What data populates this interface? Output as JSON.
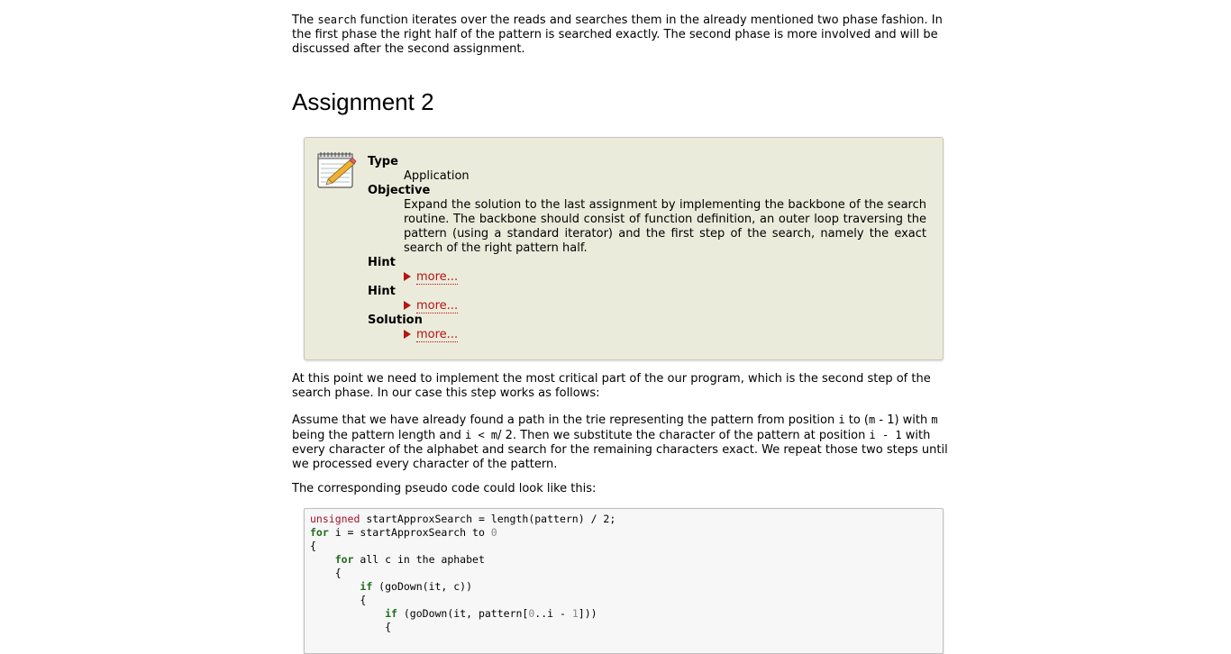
{
  "intro": {
    "before": "The ",
    "code": "search",
    "after": " function iterates over the reads and searches them in the already mentioned two phase fashion. In the first phase the right half of the pattern is searched exactly. The second phase is more involved and will be discussed after the second assignment."
  },
  "heading": "Assignment 2",
  "assignment": {
    "icon": "notepad-pencil-icon",
    "type_label": "Type",
    "type_value": "Application",
    "objective_label": "Objective",
    "objective_value": "Expand the solution to the last assignment by implementing the backbone of the search routine. The backbone should consist of function definition, an outer loop traversing the pattern (using a standard iterator) and the first step of the search, namely the exact search of the right pattern half.",
    "hint1_label": "Hint",
    "hint2_label": "Hint",
    "solution_label": "Solution",
    "more_label": "more..."
  },
  "para_critical": "At this point we need to implement the most critical part of the our program, which is the second step of the search phase. In our case this step works as follows:",
  "para_assume": {
    "t1": "Assume that we have already found a path in the trie representing the pattern from position ",
    "c1": "i",
    "t2": " to (",
    "c2": "m",
    "t3": " - 1) with ",
    "c3": "m",
    "t4": " being the pattern length and ",
    "c4": "i < m",
    "t5": "/ 2. Then we substitute the character of the pattern at position ",
    "c5": "i - 1",
    "t6": " with every character of the alphabet and search for the remaining characters exact. We repeat those two steps until we processed every character of the pattern."
  },
  "para_pseudo": "The corresponding pseudo code could look like this:",
  "code": {
    "l1_type": "unsigned",
    "l1_rest": " startApproxSearch = length(pattern) / 2;",
    "l2_kw": "for",
    "l2_rest": " i = startApproxSearch to ",
    "l2_num": "0",
    "l3": "{",
    "l4_indent": "    ",
    "l4_kw": "for",
    "l4_rest": " all c in the aphabet",
    "l5": "    {",
    "l6_indent": "        ",
    "l6_kw": "if",
    "l6_rest": " (goDown(it, c))",
    "l7": "        {",
    "l8_indent": "            ",
    "l8_kw": "if",
    "l8_rest1": " (goDown(it, pattern[",
    "l8_num1": "0",
    "l8_rest2": "..i - ",
    "l8_num2": "1",
    "l8_rest3": "]))",
    "l9": "            {"
  }
}
